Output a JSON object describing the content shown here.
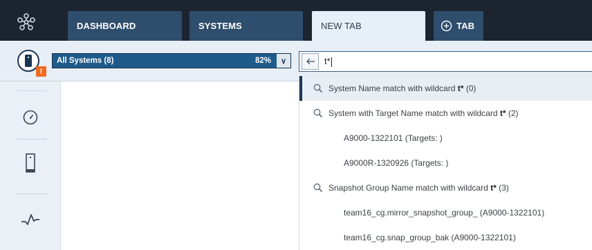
{
  "app": {
    "logo_icon": "network-nodes-icon"
  },
  "tabs": [
    {
      "label": "DASHBOARD",
      "active": false
    },
    {
      "label": "SYSTEMS",
      "active": false
    },
    {
      "label": "NEW TAB",
      "active": true
    },
    {
      "label": "TAB",
      "icon": "plus-circle-icon",
      "active": false
    }
  ],
  "system_selector": {
    "label": "All Systems (8)",
    "percent": "82%",
    "dropdown_icon": "chevron-down-icon",
    "alert_badge": "!"
  },
  "search": {
    "back_icon": "arrow-left-icon",
    "query": "t*"
  },
  "leftnav": {
    "items": [
      {
        "icon": "gauge-icon"
      },
      {
        "icon": "system-device-icon"
      },
      {
        "icon": "performance-pulse-icon"
      }
    ]
  },
  "results": [
    {
      "type": "group",
      "highlighted": true,
      "text": "System Name match with wildcard ",
      "term": "t*",
      "count": " (0)"
    },
    {
      "type": "group",
      "highlighted": false,
      "text": "System with Target Name match with wildcard ",
      "term": "t*",
      "count": " (2)"
    },
    {
      "type": "child",
      "text": "A9000-1322101 (Targets: )"
    },
    {
      "type": "child",
      "text": "A9000R-1320926 (Targets: )"
    },
    {
      "type": "group",
      "highlighted": false,
      "text": "Snapshot Group Name match with wildcard ",
      "term": "t*",
      "count": " (3)"
    },
    {
      "type": "child",
      "text": "team16_cg.mirror_snapshot_group_ (A9000-1322101)"
    },
    {
      "type": "child",
      "text": "team16_cg.snap_group_bak (A9000-1322101)"
    }
  ],
  "colors": {
    "topbar": "#1c2430",
    "tab": "#2f4d6c",
    "tab_active": "#e7f0f9",
    "selector": "#1e5b8b",
    "alert": "#f06a22"
  }
}
